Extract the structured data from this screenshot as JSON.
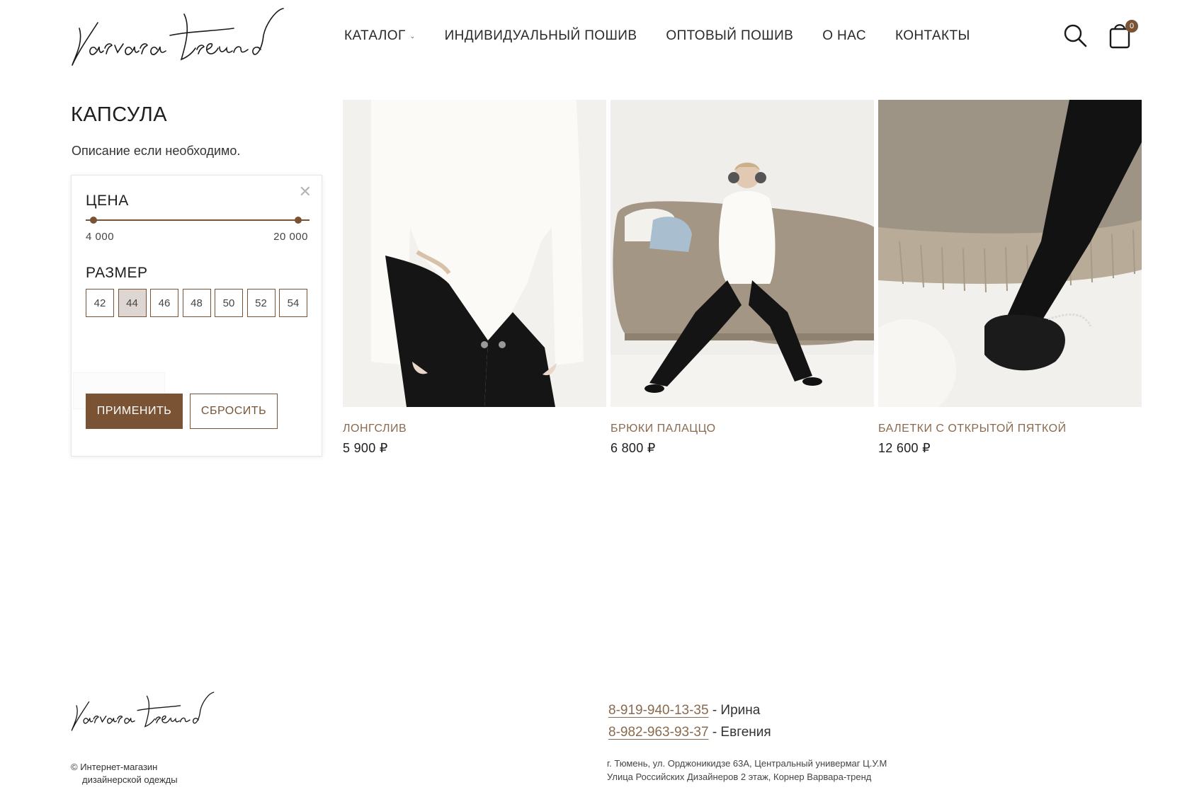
{
  "brand": {
    "logo_text": "Varvara trend",
    "accent_color": "#7a5335",
    "link_color": "#8a6a4f"
  },
  "nav": {
    "items": [
      {
        "label": "КАТАЛОГ",
        "has_dropdown": true
      },
      {
        "label": "ИНДИВИДУАЛЬНЫЙ ПОШИВ"
      },
      {
        "label": "ОПТОВЫЙ ПОШИВ"
      },
      {
        "label": "О НАС"
      },
      {
        "label": "КОНТАКТЫ"
      }
    ],
    "cart_count": "0",
    "search_icon": "search-icon",
    "cart_icon": "shopping-bag-icon"
  },
  "page": {
    "title": "КАПСУЛА",
    "description": "Описание если необходимо."
  },
  "filter": {
    "close_icon": "close-icon",
    "price_title": "ЦЕНА",
    "price_min": "4 000",
    "price_max": "20 000",
    "size_title": "РАЗМЕР",
    "sizes": [
      "42",
      "44",
      "46",
      "48",
      "50",
      "52",
      "54"
    ],
    "selected_size": "44",
    "apply_label": "ПРИМЕНИТЬ",
    "reset_label": "СБРОСИТЬ"
  },
  "products": [
    {
      "name": "ЛОНГСЛИВ",
      "price": "5 900 ₽"
    },
    {
      "name": "БРЮКИ ПАЛАЦЦО",
      "price": "6 800 ₽"
    },
    {
      "name": "БАЛЕТКИ С ОТКРЫТОЙ ПЯТКОЙ",
      "price": "12 600 ₽"
    }
  ],
  "footer": {
    "copyright_line1": "© Интернет-магазин",
    "copyright_line2": "дизайнерской одежды",
    "phones": [
      {
        "number": "8-919-940-13-35",
        "person": " - Ирина"
      },
      {
        "number": "8-982-963-93-37",
        "person": " - Евгения"
      }
    ],
    "address_line1": "г. Тюмень, ул. Орджоникидзе 63А, Центральный универмаг Ц.У.М",
    "address_line2": "Улица Российских Дизайнеров 2 этаж, Корнер Варвара-тренд"
  }
}
